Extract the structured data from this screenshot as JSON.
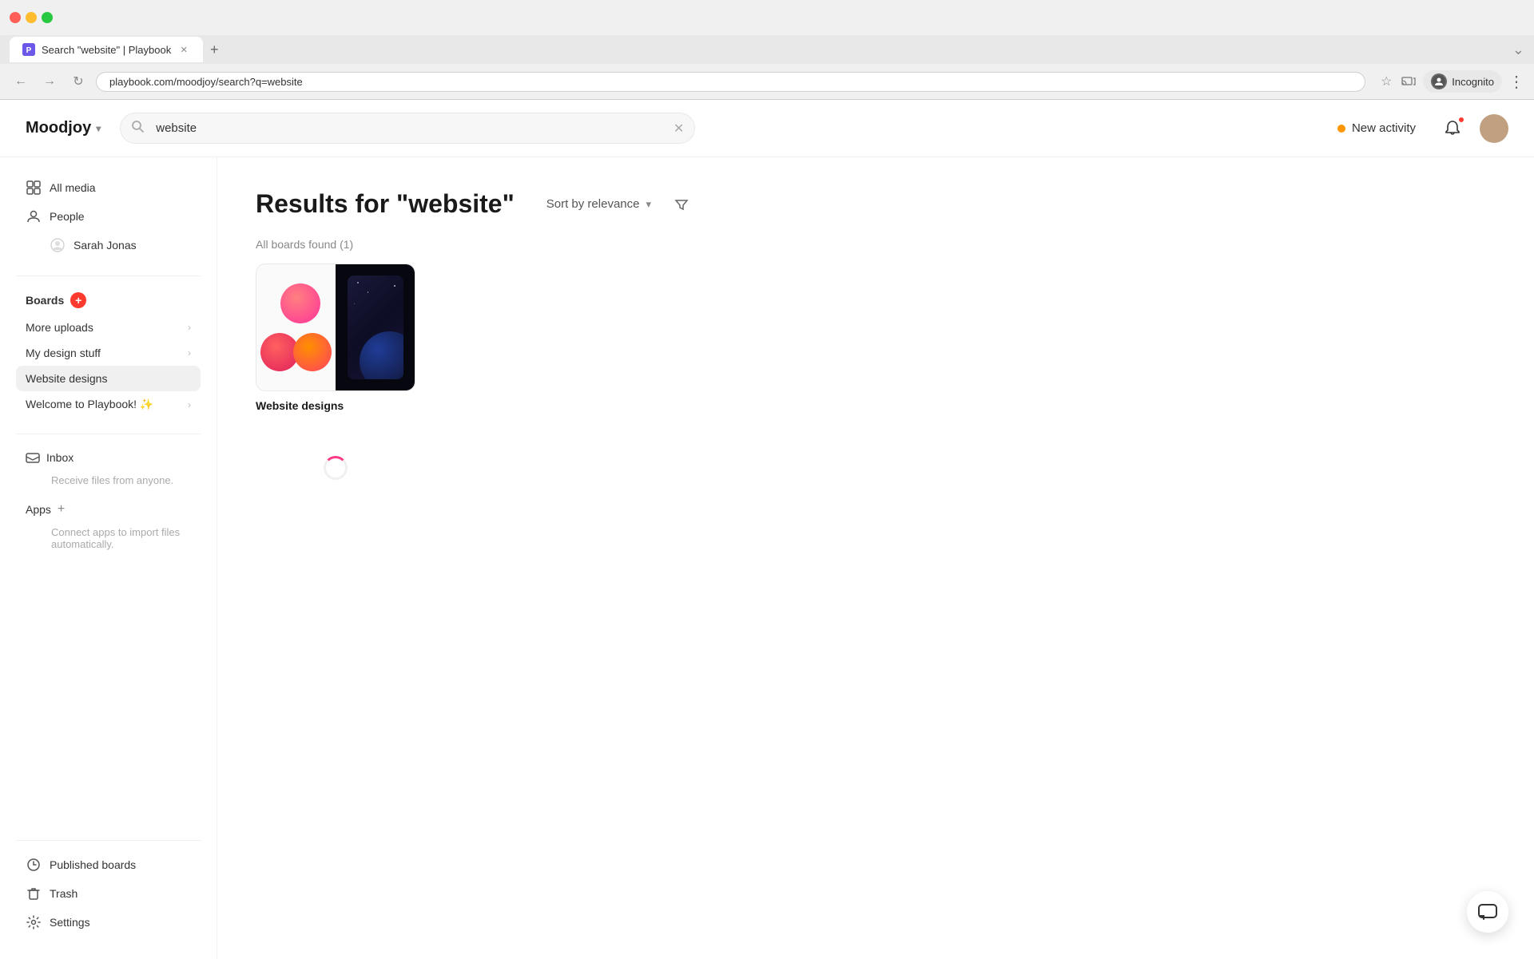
{
  "browser": {
    "tab_title": "Search \"website\" | Playbook",
    "tab_favicon": "P",
    "url": "playbook.com/moodjoy/search?q=website",
    "incognito_label": "Incognito",
    "new_tab_symbol": "+"
  },
  "header": {
    "logo": "Moodjoy",
    "search_value": "website",
    "search_placeholder": "Search",
    "new_activity_label": "New activity",
    "bell_label": "Notifications",
    "avatar_label": "User avatar"
  },
  "sidebar": {
    "all_media_label": "All media",
    "people_label": "People",
    "sarah_jonas_label": "Sarah Jonas",
    "boards_label": "Boards",
    "boards_items": [
      {
        "label": "More uploads",
        "has_chevron": true
      },
      {
        "label": "My design stuff",
        "has_chevron": true
      },
      {
        "label": "Website designs",
        "has_chevron": false
      },
      {
        "label": "Welcome to Playbook! ✨",
        "has_chevron": true
      }
    ],
    "inbox_label": "Inbox",
    "inbox_sub": "Receive files from anyone.",
    "apps_label": "Apps",
    "apps_sub": "Connect apps to import files automatically.",
    "published_boards_label": "Published boards",
    "trash_label": "Trash",
    "settings_label": "Settings"
  },
  "content": {
    "results_title": "Results for \"website\"",
    "sort_label": "Sort by relevance",
    "boards_found": "All boards found (1)",
    "board_name": "Website designs",
    "loading": true
  },
  "chat_btn": "💬"
}
